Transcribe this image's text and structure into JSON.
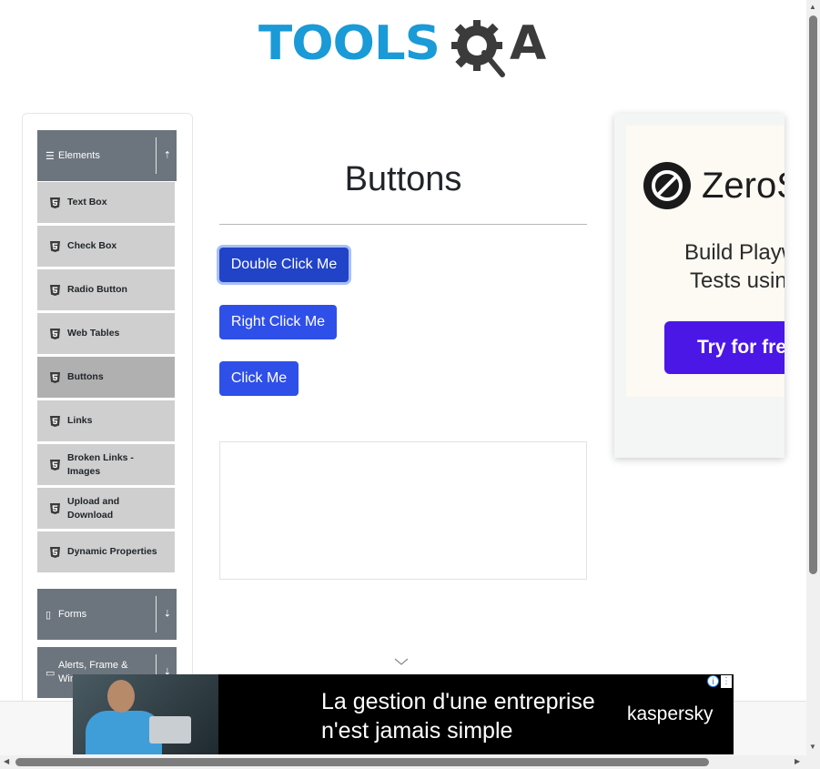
{
  "header": {
    "logo_tools": "TOOLS",
    "logo_a": "A"
  },
  "sidebar": {
    "groups": [
      {
        "label": "Elements",
        "icon": "hamburger-icon",
        "expanded": true
      },
      {
        "label": "Forms",
        "icon": "document-icon",
        "expanded": false
      },
      {
        "label": "Alerts, Frame & Win",
        "icon": "window-icon",
        "expanded": false
      }
    ],
    "items": [
      {
        "label": "Text Box"
      },
      {
        "label": "Check Box"
      },
      {
        "label": "Radio Button"
      },
      {
        "label": "Web Tables"
      },
      {
        "label": "Buttons",
        "active": true
      },
      {
        "label": "Links"
      },
      {
        "label": "Broken Links - Images"
      },
      {
        "label": "Upload and Download"
      },
      {
        "label": "Dynamic Properties"
      }
    ]
  },
  "main": {
    "title": "Buttons",
    "double_click_label": "Double Click Me",
    "right_click_label": "Right Click Me",
    "click_label": "Click Me"
  },
  "ad_right": {
    "brand": "ZeroS",
    "text_line1": "Build Playwr",
    "text_line2": "Tests using",
    "cta": "Try for free"
  },
  "ad_bottom": {
    "line1": "La gestion d'une entreprise",
    "line2": "n'est jamais simple",
    "brand": "kaspersky",
    "info": "i",
    "menu": "⋮"
  },
  "colors": {
    "primary_button": "#2f4fe9",
    "sidebar_header": "#6c757d",
    "sidebar_item": "#cfcfcf",
    "sidebar_item_active": "#b0b0b0",
    "logo_blue": "#1a9ad6",
    "logo_dark": "#3b3b3b",
    "ad_cta": "#4a17e6"
  }
}
